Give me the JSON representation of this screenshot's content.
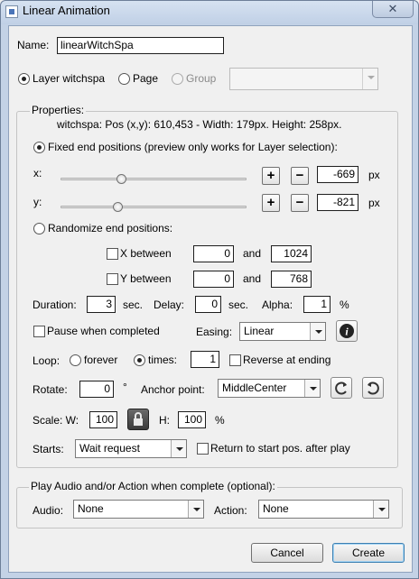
{
  "window": {
    "title": "Linear Animation",
    "close_glyph": "✕"
  },
  "name": {
    "label": "Name:",
    "value": "linearWitchSpa"
  },
  "target": {
    "options": [
      {
        "label": "Layer witchspa",
        "selected": true,
        "enabled": true
      },
      {
        "label": "Page",
        "selected": false,
        "enabled": true
      },
      {
        "label": "Group",
        "selected": false,
        "enabled": false
      }
    ],
    "group_select_value": ""
  },
  "properties": {
    "title": "Properties:",
    "info": "witchspa: Pos (x,y): 610,453 - Width: 179px. Height: 258px.",
    "fixed_label": "Fixed end positions (preview only works for Layer selection):",
    "x": {
      "label": "x:",
      "value": "-669",
      "unit": "px",
      "slider_fraction": 0.33
    },
    "y": {
      "label": "y:",
      "value": "-821",
      "unit": "px",
      "slider_fraction": 0.31
    },
    "plus_glyph": "+",
    "minus_glyph": "−",
    "randomize_label": "Randomize end positions:",
    "x_between": {
      "label": "X between",
      "from": "0",
      "and": "and",
      "to": "1024",
      "checked": false
    },
    "y_between": {
      "label": "Y between",
      "from": "0",
      "and": "and",
      "to": "768",
      "checked": false
    },
    "duration": {
      "label": "Duration:",
      "value": "3",
      "unit": "sec."
    },
    "delay": {
      "label": "Delay:",
      "value": "0",
      "unit": "sec."
    },
    "alpha": {
      "label": "Alpha:",
      "value": "1",
      "unit": "%"
    },
    "pause_label": "Pause when completed",
    "easing": {
      "label": "Easing:",
      "value": "Linear"
    },
    "info_glyph": "i",
    "loop": {
      "label": "Loop:",
      "forever_label": "forever",
      "times_label": "times:",
      "times_value": "1",
      "reverse_label": "Reverse at ending"
    },
    "rotate": {
      "label": "Rotate:",
      "value": "0",
      "unit": "°"
    },
    "anchor": {
      "label": "Anchor point:",
      "value": "MiddleCenter"
    },
    "scale": {
      "label": "Scale: W:",
      "w_value": "100",
      "h_label": "H:",
      "h_value": "100",
      "unit": "%"
    },
    "starts": {
      "label": "Starts:",
      "value": "Wait request",
      "return_label": "Return to start pos. after play"
    }
  },
  "complete": {
    "title": "Play Audio and/or Action when complete (optional):",
    "audio": {
      "label": "Audio:",
      "value": "None"
    },
    "action": {
      "label": "Action:",
      "value": "None"
    }
  },
  "buttons": {
    "cancel": "Cancel",
    "create": "Create"
  },
  "icons": {
    "lock": "lock-icon",
    "rotate_ccw": "rotate-ccw-icon",
    "rotate_cw": "rotate-cw-icon",
    "info": "info-icon"
  }
}
